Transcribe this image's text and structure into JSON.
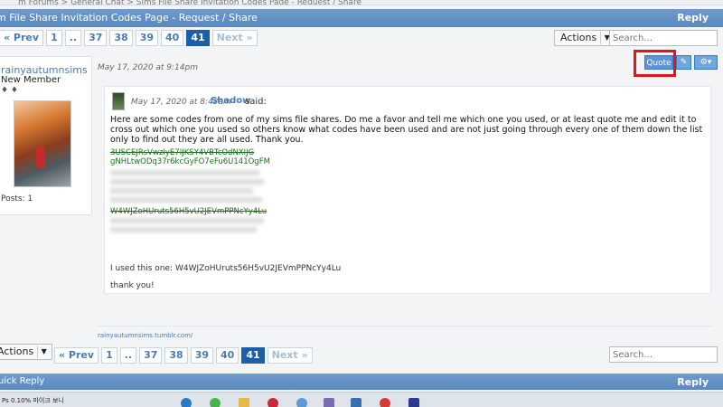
{
  "breadcrumb_strip": "m Forums  >  General Chat  >  Sims File Share Invitation Codes Page - Request / Share",
  "thread": {
    "title": "m File Share Invitation Codes Page - Request / Share",
    "reply_label": "Reply"
  },
  "pager": {
    "prev": "« Prev",
    "pages": [
      "1",
      "..",
      "37",
      "38",
      "39",
      "40",
      "41"
    ],
    "current": "41",
    "next": "Next »"
  },
  "actions_label": "Actions",
  "search_placeholder": "Search...",
  "user": {
    "name": "rainyautumnsims",
    "role": "New Member",
    "icons": "♦ ♦",
    "posts": "Posts: 1"
  },
  "post": {
    "date": "May 17, 2020 at 9:14pm",
    "quote_label": "Quote",
    "quote": {
      "date": "May 17, 2020 at 8:43am",
      "author": "Shadow",
      "said": "said:",
      "text": "Here are some codes from one of my sims file shares. Do me a favor and tell me which one you used, or at least quote me and edit it to cross out which one you used so others know what codes have been used and are not just going through every one of them down the list only to find out they are all used. Thank you.",
      "codes": [
        "3USCEJRsVwzIyE7IJKSY4VBTcOdNXIJG",
        "gNHLtwODq37r6kcGyFO7eFu6U141OgFM",
        "W4WJZoHUruts56H5vU2JEVmPPNcYy4Lu"
      ]
    },
    "reply": "I used this one: W4WJZoHUruts56H5vU2JEVmPPNcYy4Lu",
    "thanks": "thank you!",
    "signature": "rainyautumnsims.tumblr.com/"
  },
  "quick_reply": {
    "title": "uick Reply",
    "reply_label": "Reply"
  },
  "taskbar": {
    "label": "Ps 0.10% 마이크 보니"
  }
}
